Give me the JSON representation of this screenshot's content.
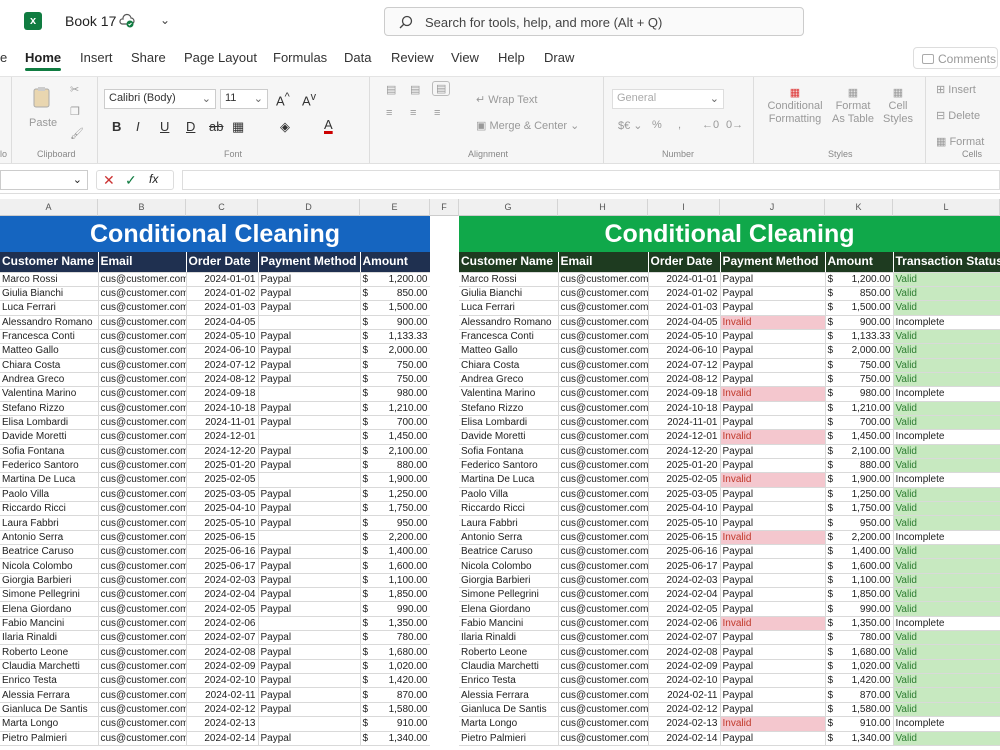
{
  "app": {
    "title": "Book 17",
    "search_placeholder": "Search for tools, help, and more (Alt + Q)"
  },
  "tabs": [
    "e",
    "Home",
    "Insert",
    "Share",
    "Page Layout",
    "Formulas",
    "Data",
    "Review",
    "View",
    "Help",
    "Draw"
  ],
  "comments_label": "Comments",
  "ribbon": {
    "paste": "Paste",
    "clipboard": "Clipboard",
    "font_name": "Calibri (Body)",
    "font_size": "11",
    "font": "Font",
    "wrap_text": "Wrap Text",
    "merge_center": "Merge & Center",
    "alignment": "Alignment",
    "number_format": "General",
    "number": "Number",
    "cond_format": "Conditional Formatting",
    "format_table": "Format As Table",
    "cell_styles": "Cell Styles",
    "styles": "Styles",
    "insert": "Insert",
    "delete": "Delete",
    "format": "Format",
    "cells": "Cells",
    "clip_label_left": "lo"
  },
  "columns_left": [
    "A",
    "B",
    "C",
    "D",
    "E",
    "F"
  ],
  "columns_right": [
    "G",
    "H",
    "I",
    "J",
    "K",
    "L"
  ],
  "left_table": {
    "title": "Conditional Cleaning",
    "headers": [
      "Customer Name",
      "Email",
      "Order Date",
      "Payment Method",
      "Amount"
    ]
  },
  "right_table": {
    "title": "Conditional Cleaning",
    "headers": [
      "Customer Name",
      "Email",
      "Order Date",
      "Payment Method",
      "Amount",
      "Transaction Status"
    ]
  },
  "rows": [
    [
      "Marco Rossi",
      "cus@customer.com",
      "2024-01-01",
      "Paypal",
      "1,200.00"
    ],
    [
      "Giulia Bianchi",
      "cus@customer.com",
      "2024-01-02",
      "Paypal",
      "850.00"
    ],
    [
      "Luca Ferrari",
      "cus@customer.com",
      "2024-01-03",
      "Paypal",
      "1,500.00"
    ],
    [
      "Alessandro Romano",
      "cus@customer.com",
      "2024-04-05",
      "",
      "900.00"
    ],
    [
      "Francesca Conti",
      "cus@customer.com",
      "2024-05-10",
      "Paypal",
      "1,133.33"
    ],
    [
      "Matteo Gallo",
      "cus@customer.com",
      "2024-06-10",
      "Paypal",
      "2,000.00"
    ],
    [
      "Chiara Costa",
      "cus@customer.com",
      "2024-07-12",
      "Paypal",
      "750.00"
    ],
    [
      "Andrea Greco",
      "cus@customer.com",
      "2024-08-12",
      "Paypal",
      "750.00"
    ],
    [
      "Valentina Marino",
      "cus@customer.com",
      "2024-09-18",
      "",
      "980.00"
    ],
    [
      "Stefano Rizzo",
      "cus@customer.com",
      "2024-10-18",
      "Paypal",
      "1,210.00"
    ],
    [
      "Elisa Lombardi",
      "cus@customer.com",
      "2024-11-01",
      "Paypal",
      "700.00"
    ],
    [
      "Davide Moretti",
      "cus@customer.com",
      "2024-12-01",
      "",
      "1,450.00"
    ],
    [
      "Sofia Fontana",
      "cus@customer.com",
      "2024-12-20",
      "Paypal",
      "2,100.00"
    ],
    [
      "Federico Santoro",
      "cus@customer.com",
      "2025-01-20",
      "Paypal",
      "880.00"
    ],
    [
      "Martina De Luca",
      "cus@customer.com",
      "2025-02-05",
      "",
      "1,900.00"
    ],
    [
      "Paolo Villa",
      "cus@customer.com",
      "2025-03-05",
      "Paypal",
      "1,250.00"
    ],
    [
      "Riccardo Ricci",
      "cus@customer.com",
      "2025-04-10",
      "Paypal",
      "1,750.00"
    ],
    [
      "Laura Fabbri",
      "cus@customer.com",
      "2025-05-10",
      "Paypal",
      "950.00"
    ],
    [
      "Antonio Serra",
      "cus@customer.com",
      "2025-06-15",
      "",
      "2,200.00"
    ],
    [
      "Beatrice Caruso",
      "cus@customer.com",
      "2025-06-16",
      "Paypal",
      "1,400.00"
    ],
    [
      "Nicola Colombo",
      "cus@customer.com",
      "2025-06-17",
      "Paypal",
      "1,600.00"
    ],
    [
      "Giorgia Barbieri",
      "cus@customer.com",
      "2024-02-03",
      "Paypal",
      "1,100.00"
    ],
    [
      "Simone Pellegrini",
      "cus@customer.com",
      "2024-02-04",
      "Paypal",
      "1,850.00"
    ],
    [
      "Elena Giordano",
      "cus@customer.com",
      "2024-02-05",
      "Paypal",
      "990.00"
    ],
    [
      "Fabio Mancini",
      "cus@customer.com",
      "2024-02-06",
      "",
      "1,350.00"
    ],
    [
      "Ilaria Rinaldi",
      "cus@customer.com",
      "2024-02-07",
      "Paypal",
      "780.00"
    ],
    [
      "Roberto Leone",
      "cus@customer.com",
      "2024-02-08",
      "Paypal",
      "1,680.00"
    ],
    [
      "Claudia Marchetti",
      "cus@customer.com",
      "2024-02-09",
      "Paypal",
      "1,020.00"
    ],
    [
      "Enrico Testa",
      "cus@customer.com",
      "2024-02-10",
      "Paypal",
      "1,420.00"
    ],
    [
      "Alessia Ferrara",
      "cus@customer.com",
      "2024-02-11",
      "Paypal",
      "870.00"
    ],
    [
      "Gianluca De Santis",
      "cus@customer.com",
      "2024-02-12",
      "Paypal",
      "1,580.00"
    ],
    [
      "Marta Longo",
      "cus@customer.com",
      "2024-02-13",
      "",
      "910.00"
    ],
    [
      "Pietro Palmieri",
      "cus@customer.com",
      "2024-02-14",
      "Paypal",
      "1,340.00"
    ]
  ],
  "currency": "$",
  "invalid_label": "Invalid",
  "valid_label": "Valid",
  "incomplete_label": "Incomplete",
  "colors": {
    "left_title": "#1565c0",
    "left_header": "#1f3050",
    "right_title": "#10a84a",
    "right_header": "#1e3b20",
    "valid_fill": "#c7e9c0",
    "invalid_fill": "#f4c7ce"
  }
}
